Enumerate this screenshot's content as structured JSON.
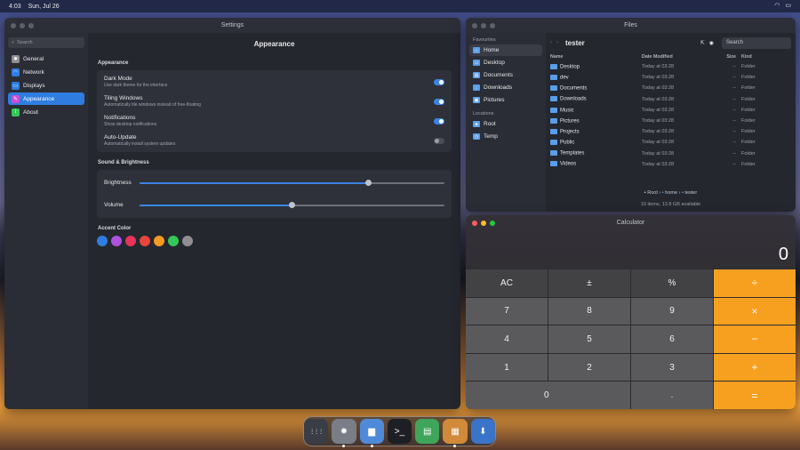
{
  "topbar": {
    "time": "4:03",
    "date": "Sun, Jul 26"
  },
  "settings": {
    "title": "Settings",
    "search_placeholder": "Search",
    "nav": [
      {
        "label": "General",
        "icon": "gear-icon",
        "color": "#8e8e93"
      },
      {
        "label": "Network",
        "icon": "wifi-icon",
        "color": "#2f7de0"
      },
      {
        "label": "Displays",
        "icon": "display-icon",
        "color": "#2f7de0"
      },
      {
        "label": "Appearance",
        "icon": "brush-icon",
        "color": "#c94dd6",
        "active": true
      },
      {
        "label": "About",
        "icon": "info-icon",
        "color": "#34c759"
      }
    ],
    "page_title": "Appearance",
    "appearance_header": "Appearance",
    "toggles": [
      {
        "title": "Dark Mode",
        "desc": "Use dark theme for the interface",
        "on": true
      },
      {
        "title": "Tiling Windows",
        "desc": "Automatically tile windows instead of free-floating",
        "on": true
      },
      {
        "title": "Notifications",
        "desc": "Show desktop notifications",
        "on": true
      },
      {
        "title": "Auto-Update",
        "desc": "Automatically install system updates",
        "on": false
      }
    ],
    "sound_header": "Sound & Brightness",
    "sliders": [
      {
        "label": "Brightness",
        "value": 0.75
      },
      {
        "label": "Volume",
        "value": 0.5
      }
    ],
    "accent_header": "Accent Color",
    "accent_colors": [
      "#2f7de0",
      "#af52de",
      "#e6345a",
      "#e8453c",
      "#f59a23",
      "#34c759",
      "#8e8e93"
    ]
  },
  "files": {
    "title": "Files",
    "sidebar": {
      "favourites_header": "Favourites",
      "favourites": [
        "Home",
        "Desktop",
        "Documents",
        "Downloads",
        "Pictures"
      ],
      "locations_header": "Locations",
      "locations": [
        "Root",
        "Temp"
      ]
    },
    "current_folder": "tester",
    "search": "Search",
    "columns": {
      "name": "Name",
      "date": "Date Modified",
      "size": "Size",
      "kind": "Kind"
    },
    "rows": [
      {
        "name": "Desktop",
        "date": "Today at 03:28",
        "size": "--",
        "kind": "Folder"
      },
      {
        "name": "dev",
        "date": "Today at 03:28",
        "size": "--",
        "kind": "Folder"
      },
      {
        "name": "Documents",
        "date": "Today at 03:28",
        "size": "--",
        "kind": "Folder"
      },
      {
        "name": "Downloads",
        "date": "Today at 03:28",
        "size": "--",
        "kind": "Folder"
      },
      {
        "name": "Music",
        "date": "Today at 03:28",
        "size": "--",
        "kind": "Folder"
      },
      {
        "name": "Pictures",
        "date": "Today at 03:28",
        "size": "--",
        "kind": "Folder"
      },
      {
        "name": "Projects",
        "date": "Today at 03:28",
        "size": "--",
        "kind": "Folder"
      },
      {
        "name": "Public",
        "date": "Today at 03:28",
        "size": "--",
        "kind": "Folder"
      },
      {
        "name": "Templates",
        "date": "Today at 03:28",
        "size": "--",
        "kind": "Folder"
      },
      {
        "name": "Videos",
        "date": "Today at 03:28",
        "size": "--",
        "kind": "Folder"
      }
    ],
    "path": [
      "Root",
      "home",
      "tester"
    ],
    "status": "10 items, 13.8 GB available"
  },
  "calculator": {
    "title": "Calculator",
    "display": "0",
    "keys": [
      {
        "label": "AC",
        "kind": "top"
      },
      {
        "label": "±",
        "kind": "top"
      },
      {
        "label": "%",
        "kind": "top"
      },
      {
        "label": "÷",
        "kind": "op"
      },
      {
        "label": "7"
      },
      {
        "label": "8"
      },
      {
        "label": "9"
      },
      {
        "label": "×",
        "kind": "op"
      },
      {
        "label": "4"
      },
      {
        "label": "5"
      },
      {
        "label": "6"
      },
      {
        "label": "−",
        "kind": "op"
      },
      {
        "label": "1"
      },
      {
        "label": "2"
      },
      {
        "label": "3"
      },
      {
        "label": "+",
        "kind": "op"
      },
      {
        "label": "0",
        "kind": "zero"
      },
      {
        "label": "."
      },
      {
        "label": "=",
        "kind": "op"
      }
    ]
  },
  "dock": [
    {
      "name": "app-grid-icon",
      "glyph": "⋮⋮⋮",
      "color": "#3a3d45",
      "running": false
    },
    {
      "name": "settings-icon",
      "glyph": "✸",
      "color": "#7a7d86",
      "running": true
    },
    {
      "name": "files-icon",
      "glyph": "▆",
      "color": "#4f8ad8",
      "running": true
    },
    {
      "name": "terminal-icon",
      "glyph": ">_",
      "color": "#1e1f24",
      "running": false
    },
    {
      "name": "notes-icon",
      "glyph": "▤",
      "color": "#3fa55a",
      "running": false
    },
    {
      "name": "calculator-icon",
      "glyph": "▦",
      "color": "#d08a3a",
      "running": true
    },
    {
      "name": "installer-icon",
      "glyph": "⬇",
      "color": "#3a74c8",
      "running": false
    }
  ]
}
